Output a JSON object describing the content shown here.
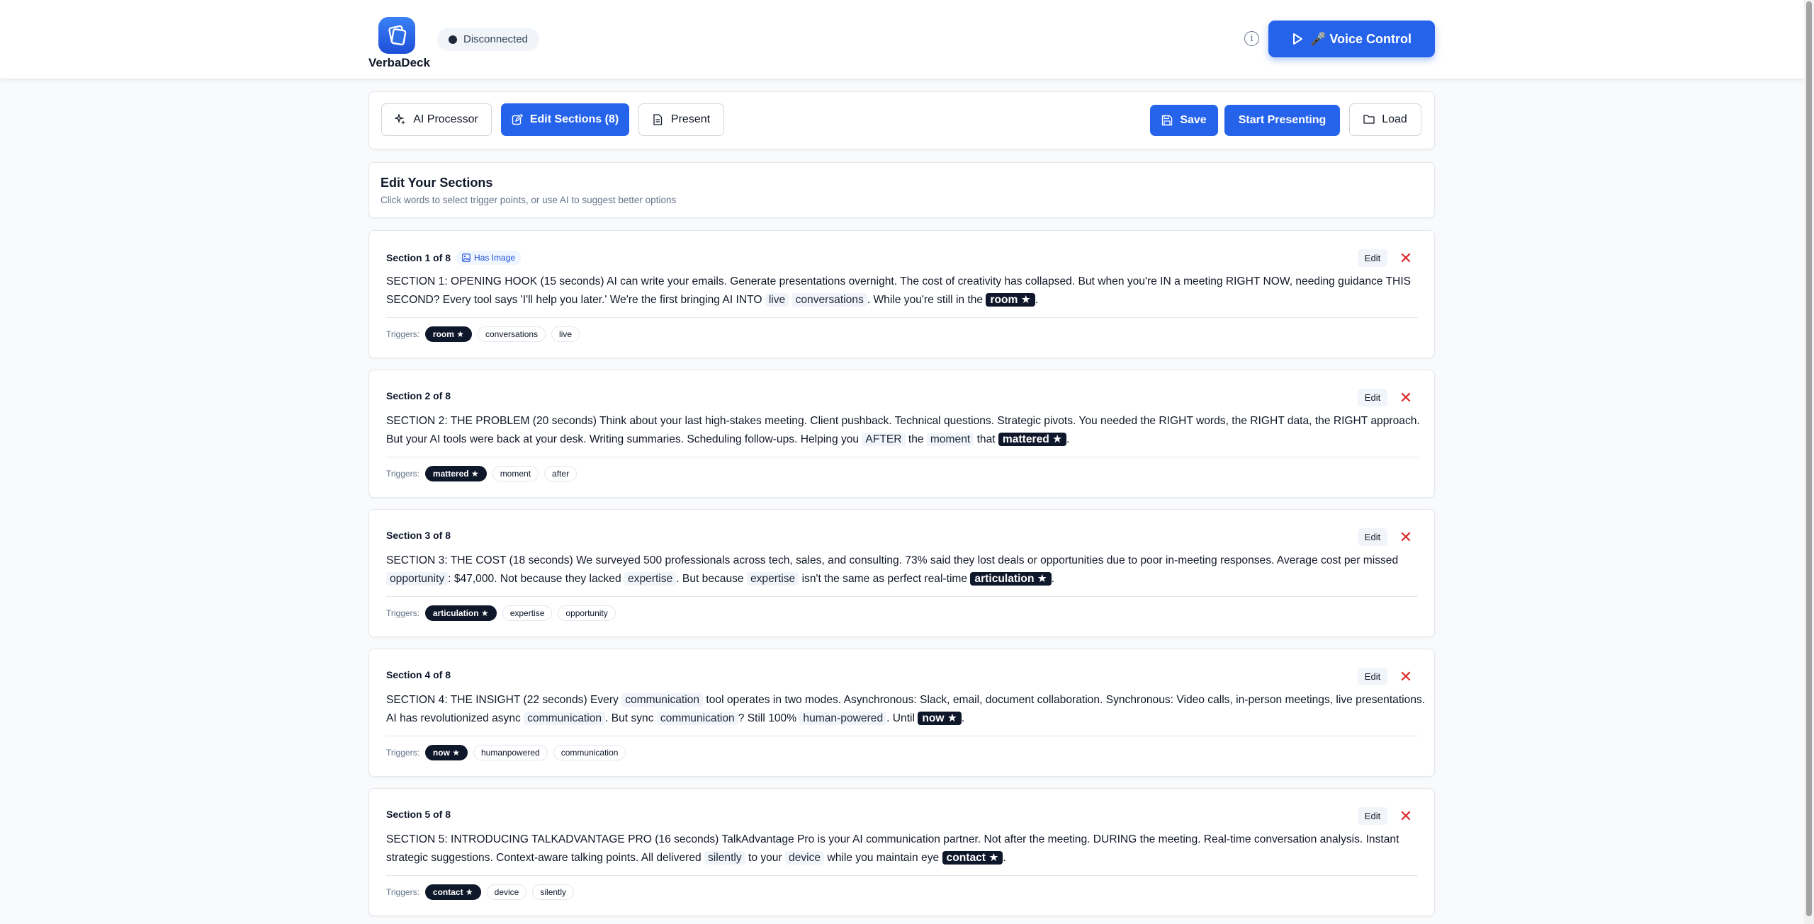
{
  "header": {
    "brand": "VerbaDeck",
    "status": "Disconnected",
    "info_glyph": "i",
    "voice_button": "🎤 Voice Control"
  },
  "toolbar": {
    "ai_processor": "AI Processor",
    "edit_sections": "Edit Sections (8)",
    "present": "Present",
    "save": "Save",
    "start_presenting": "Start Presenting",
    "load": "Load"
  },
  "intro": {
    "title": "Edit Your Sections",
    "subtitle": "Click words to select trigger points, or use AI to suggest better options"
  },
  "labels": {
    "edit": "Edit",
    "close": "✕",
    "triggers": "Triggers:",
    "has_image": "Has Image"
  },
  "sections": [
    {
      "title": "Section 1 of 8",
      "has_image": true,
      "parts": [
        {
          "t": "SECTION 1: OPENING HOOK (15 seconds) AI can write your emails. Generate presentations overnight. The cost of creativity has collapsed. But when you're IN a meeting RIGHT NOW, needing guidance THIS SECOND? Every tool says 'I'll help you later.' We're the first bringing AI INTO "
        },
        {
          "t": "live",
          "k": "hl"
        },
        {
          "t": " "
        },
        {
          "t": "conversations",
          "k": "hl"
        },
        {
          "t": ". While you're still in the "
        },
        {
          "t": "room ★",
          "k": "star"
        },
        {
          "t": "."
        }
      ],
      "triggers": [
        "room ★",
        "conversations",
        "live"
      ]
    },
    {
      "title": "Section 2 of 8",
      "has_image": false,
      "parts": [
        {
          "t": "SECTION 2: THE PROBLEM (20 seconds) Think about your last high-stakes meeting. Client pushback. Technical questions. Strategic pivots. You needed the RIGHT words, the RIGHT data, the RIGHT approach. But your AI tools were back at your desk. Writing summaries. Scheduling follow-ups. Helping you "
        },
        {
          "t": "AFTER",
          "k": "hl"
        },
        {
          "t": " the "
        },
        {
          "t": "moment",
          "k": "hl"
        },
        {
          "t": " that "
        },
        {
          "t": "mattered ★",
          "k": "star"
        },
        {
          "t": "."
        }
      ],
      "triggers": [
        "mattered ★",
        "moment",
        "after"
      ]
    },
    {
      "title": "Section 3 of 8",
      "has_image": false,
      "parts": [
        {
          "t": "SECTION 3: THE COST (18 seconds) We surveyed 500 professionals across tech, sales, and consulting. 73% said they lost deals or opportunities due to poor in-meeting responses. Average cost per missed "
        },
        {
          "t": "opportunity",
          "k": "hl"
        },
        {
          "t": ": $47,000. Not because they lacked "
        },
        {
          "t": "expertise",
          "k": "hl"
        },
        {
          "t": ". But because "
        },
        {
          "t": "expertise",
          "k": "hl"
        },
        {
          "t": " isn't the same as perfect real-time "
        },
        {
          "t": "articulation ★",
          "k": "star"
        },
        {
          "t": "."
        }
      ],
      "triggers": [
        "articulation ★",
        "expertise",
        "opportunity"
      ]
    },
    {
      "title": "Section 4 of 8",
      "has_image": false,
      "parts": [
        {
          "t": "SECTION 4: THE INSIGHT (22 seconds) Every "
        },
        {
          "t": "communication",
          "k": "hl"
        },
        {
          "t": " tool operates in two modes. Asynchronous: Slack, email, document collaboration. Synchronous: Video calls, in-person meetings, live presentations. AI has revolutionized async "
        },
        {
          "t": "communication",
          "k": "hl"
        },
        {
          "t": ". But sync "
        },
        {
          "t": "communication",
          "k": "hl"
        },
        {
          "t": "? Still 100% "
        },
        {
          "t": "human-powered",
          "k": "hl"
        },
        {
          "t": ". Until "
        },
        {
          "t": "now ★",
          "k": "star"
        },
        {
          "t": "."
        }
      ],
      "triggers": [
        "now ★",
        "humanpowered",
        "communication"
      ]
    },
    {
      "title": "Section 5 of 8",
      "has_image": false,
      "parts": [
        {
          "t": "SECTION 5: INTRODUCING TALKADVANTAGE PRO (16 seconds) TalkAdvantage Pro is your AI communication partner. Not after the meeting. DURING the meeting. Real-time conversation analysis. Instant strategic suggestions. Context-aware talking points. All delivered "
        },
        {
          "t": "silently",
          "k": "hl"
        },
        {
          "t": " to your "
        },
        {
          "t": "device",
          "k": "hl"
        },
        {
          "t": " while you maintain eye "
        },
        {
          "t": "contact ★",
          "k": "star"
        },
        {
          "t": "."
        }
      ],
      "triggers": [
        "contact ★",
        "device",
        "silently"
      ]
    }
  ]
}
